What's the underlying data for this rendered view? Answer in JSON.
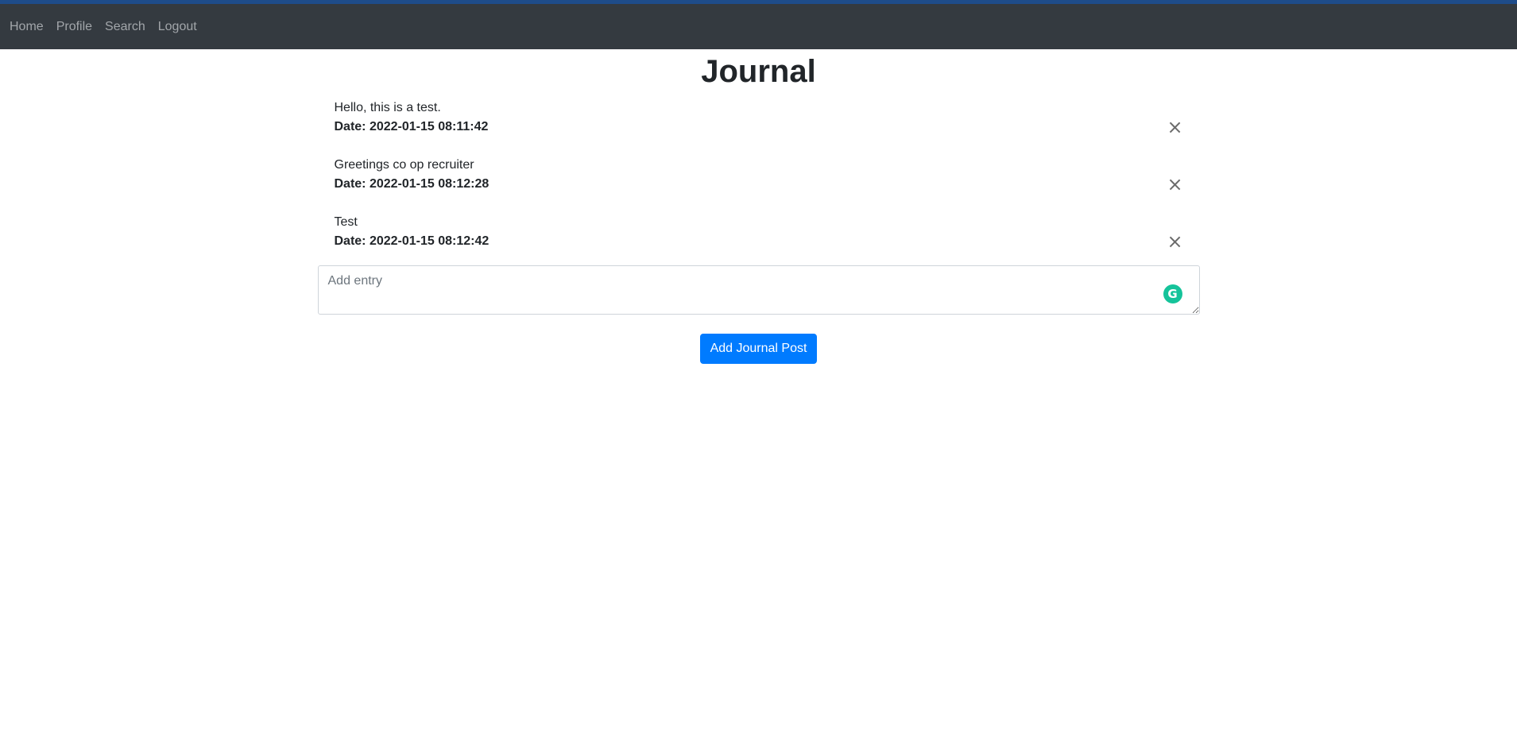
{
  "nav": {
    "items": [
      {
        "label": "Home"
      },
      {
        "label": "Profile"
      },
      {
        "label": "Search"
      },
      {
        "label": "Logout"
      }
    ]
  },
  "page": {
    "title": "Journal"
  },
  "entries": [
    {
      "text": "Hello, this is a test.",
      "date": "Date: 2022-01-15 08:11:42",
      "delete_icon": "close-icon"
    },
    {
      "text": "Greetings co op recruiter",
      "date": "Date: 2022-01-15 08:12:28",
      "delete_icon": "close-icon"
    },
    {
      "text": "Test",
      "date": "Date: 2022-01-15 08:12:42",
      "delete_icon": "close-icon"
    }
  ],
  "form": {
    "entry_placeholder": "Add entry",
    "entry_value": "",
    "submit_label": "Add Journal Post"
  },
  "icons": {
    "close": "×",
    "grammarly": "G"
  },
  "colors": {
    "navbar": "#343a40",
    "primary": "#007bff",
    "grammarly": "#15c39a"
  }
}
